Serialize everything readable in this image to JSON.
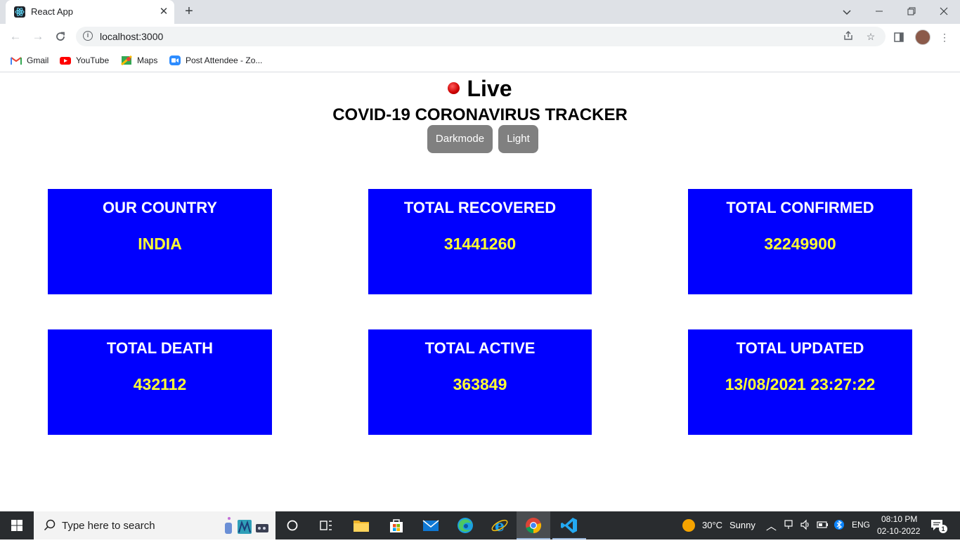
{
  "browser": {
    "tab_title": "React App",
    "tab_favicon": "react-icon",
    "url": "localhost:3000",
    "bookmarks": [
      {
        "label": "Gmail",
        "icon": "gmail-icon"
      },
      {
        "label": "YouTube",
        "icon": "youtube-icon"
      },
      {
        "label": "Maps",
        "icon": "maps-icon"
      },
      {
        "label": "Post Attendee - Zo...",
        "icon": "zoom-icon"
      }
    ]
  },
  "page": {
    "live_label": "Live",
    "title": "COVID-19 CORONAVIRUS TRACKER",
    "buttons": {
      "dark": "Darkmode",
      "light": "Light"
    },
    "cards": [
      {
        "label": "OUR COUNTRY",
        "value": "INDIA"
      },
      {
        "label": "TOTAL RECOVERED",
        "value": "31441260"
      },
      {
        "label": "TOTAL CONFIRMED",
        "value": "32249900"
      },
      {
        "label": "TOTAL DEATH",
        "value": "432112"
      },
      {
        "label": "TOTAL ACTIVE",
        "value": "363849"
      },
      {
        "label": "TOTAL UPDATED",
        "value": "13/08/2021 23:27:22"
      }
    ],
    "colors": {
      "card_bg": "#0000ff",
      "card_label": "#ffffff",
      "card_value": "#ffff33",
      "button_bg": "#808080",
      "live_dot": "#cc0000"
    }
  },
  "taskbar": {
    "search_placeholder": "Type here to search",
    "weather": {
      "temp": "30°C",
      "condition": "Sunny"
    },
    "language": "ENG",
    "time": "08:10 PM",
    "date": "02-10-2022",
    "notification_count": "1"
  }
}
